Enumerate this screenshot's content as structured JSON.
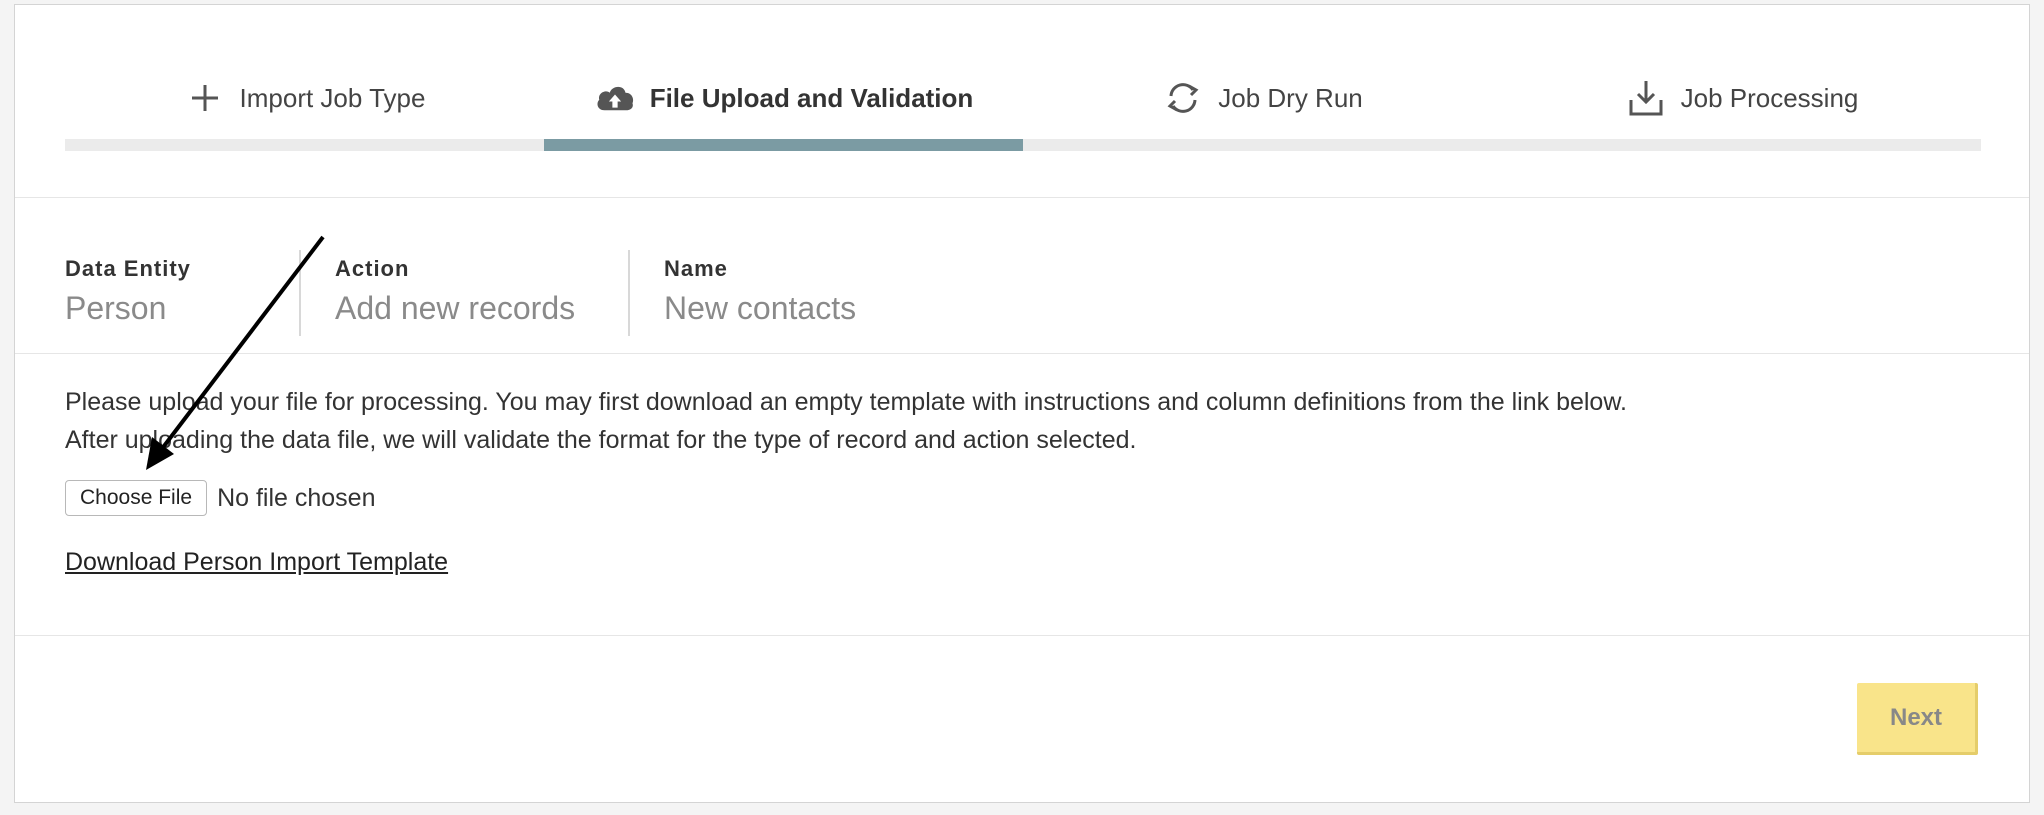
{
  "stepper": {
    "steps": [
      {
        "label": "Import Job Type",
        "icon": "plus-icon",
        "active": false
      },
      {
        "label": "File Upload and Validation",
        "icon": "cloud-upload-icon",
        "active": true
      },
      {
        "label": "Job Dry Run",
        "icon": "refresh-icon",
        "active": false
      },
      {
        "label": "Job Processing",
        "icon": "download-icon",
        "active": false
      }
    ],
    "progress": 0.5,
    "active_color": "#7b9ba3"
  },
  "summary": {
    "data_entity": {
      "label": "Data Entity",
      "value": "Person"
    },
    "action": {
      "label": "Action",
      "value": "Add new records"
    },
    "name": {
      "label": "Name",
      "value": "New contacts"
    }
  },
  "instructions": {
    "line1": "Please upload your file for processing. You may first download an empty template with instructions and column definitions from the link below.",
    "line2": "After uploading the data file, we will validate the format for the type of record and action selected."
  },
  "file_input": {
    "button_label": "Choose File",
    "status": "No file chosen"
  },
  "download_link": "Download Person Import Template",
  "footer": {
    "next_label": "Next",
    "next_color": "#f9e48a"
  }
}
